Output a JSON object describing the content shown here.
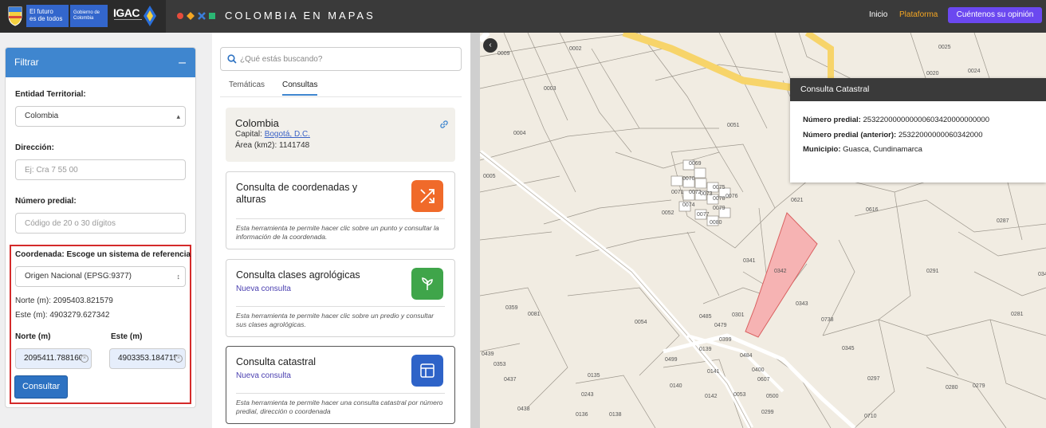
{
  "header": {
    "gov_line1": "El futuro",
    "gov_line2": "es de todos",
    "gov_badge": "Gobierno de Colombia",
    "igac": "IGAC",
    "brand": "COLOMBIA EN MAPAS",
    "nav_inicio": "Inicio",
    "nav_plataforma": "Plataforma",
    "nav_opinion": "Cuéntenos su opinión"
  },
  "filter": {
    "title": "Filtrar",
    "entidad_label": "Entidad Territorial:",
    "entidad_value": "Colombia",
    "direccion_label": "Dirección:",
    "direccion_placeholder": "Ej: Cra 7 55 00",
    "predial_label": "Número predial:",
    "predial_placeholder": "Código de 20 o 30 dígitos",
    "coord_label": "Coordenada: Escoge un sistema de referencia",
    "coord_system": "Origen Nacional (EPSG:9377)",
    "norte_readout": "Norte (m): 2095403.821579",
    "este_readout": "Este (m): 4903279.627342",
    "norte_input_label": "Norte (m)",
    "este_input_label": "Este (m)",
    "norte_value": "2095411.788160",
    "este_value": "4903353.184715",
    "submit": "Consultar"
  },
  "search": {
    "placeholder": "¿Qué estás buscando?"
  },
  "tabs": [
    {
      "label": "Temáticas"
    },
    {
      "label": "Consultas"
    }
  ],
  "country": {
    "name": "Colombia",
    "capital_label": "Capital:",
    "capital_value": "Bogotá, D.C.",
    "area_label": "Área (km2):",
    "area_value": "1141748"
  },
  "cards": [
    {
      "title": "Consulta de coordenadas y alturas",
      "subtitle": "",
      "desc": "Esta herramienta te permite hacer clic sobre un punto y consultar la información de la coordenada.",
      "color": "#f06a2a"
    },
    {
      "title": "Consulta clases agrológicas",
      "subtitle": "Nueva consulta",
      "desc": "Esta herramienta te permite hacer clic sobre un predio y consultar sus clases agrológicas.",
      "color": "#3fa54a"
    },
    {
      "title": "Consulta catastral",
      "subtitle": "Nueva consulta",
      "desc": "Esta herramienta te permite hacer una consulta catastral por número predial, dirección o coordenada",
      "color": "#2e63c8"
    }
  ],
  "popup": {
    "title": "Consulta Catastral",
    "predial_label": "Número predial:",
    "predial_value": "253220000000000603420000000000",
    "anterior_label": "Número predial (anterior):",
    "anterior_value": "25322000000060342000",
    "municipio_label": "Municipio:",
    "municipio_value": "Guasca, Cundinamarca"
  },
  "map_labels": [
    "0009",
    "0002",
    "0025",
    "0024",
    "0003",
    "0020",
    "0051",
    "0004",
    "0069",
    "0070",
    "0071",
    "0072",
    "0073",
    "0075",
    "0074",
    "0076",
    "0077",
    "0078",
    "0079",
    "0080",
    "0052",
    "0005",
    "0621",
    "0616",
    "0287",
    "0341",
    "0342",
    "0291",
    "0343",
    "0738",
    "0359",
    "0081",
    "0054",
    "0485",
    "0479",
    "0301",
    "0399",
    "0139",
    "0484",
    "0345",
    "0281",
    "0499",
    "0141",
    "0400",
    "0607",
    "0297",
    "0140",
    "0142",
    "0053",
    "0500",
    "0135",
    "0243",
    "0280",
    "0279",
    "0437",
    "0136",
    "0138",
    "0438",
    "0299",
    "0710",
    "0439",
    "0353",
    "0345"
  ]
}
